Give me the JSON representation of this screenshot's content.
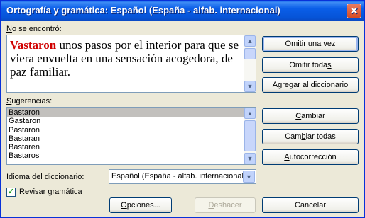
{
  "window": {
    "title": "Ortografía y gramática: Español (España - alfab. internacional)",
    "close_glyph": "✕"
  },
  "not_found": {
    "label_prefix": "",
    "label_u": "N",
    "label_rest": "o se encontró:",
    "error_word": "Vastaron",
    "text_rest": " unos pasos por el interior para que se viera envuelta en una sensación acogedora, de paz familiar."
  },
  "suggestions": {
    "label_u": "S",
    "label_rest": "ugerencias:",
    "items": [
      "Bastaron",
      "Gastaron",
      "Pastaron",
      "Bastaran",
      "Bastaren",
      "Bastaros"
    ]
  },
  "buttons": {
    "ignore_once": {
      "pre": "Omi",
      "u": "t",
      "post": "ir una vez"
    },
    "ignore_all": {
      "pre": "Omitir toda",
      "u": "s",
      "post": ""
    },
    "add_dict": {
      "pre": "A",
      "u": "g",
      "post": "regar al diccionario"
    },
    "change": {
      "pre": "",
      "u": "C",
      "post": "ambiar"
    },
    "change_all": {
      "pre": "Cam",
      "u": "b",
      "post": "iar todas"
    },
    "autocorrect": {
      "pre": "",
      "u": "A",
      "post": "utocorrección"
    },
    "options": {
      "pre": "",
      "u": "O",
      "post": "pciones..."
    },
    "undo": {
      "pre": "",
      "u": "D",
      "post": "eshacer"
    },
    "cancel": {
      "pre": "Cancelar",
      "u": "",
      "post": ""
    }
  },
  "dictionary_language": {
    "label_pre": "Idioma del ",
    "label_u": "d",
    "label_post": "iccionario:",
    "value": "Español (España - alfab. internacional)"
  },
  "check_grammar": {
    "checked": true,
    "label_pre": "",
    "label_u": "R",
    "label_post": "evisar gramática",
    "check_glyph": "✓"
  },
  "icons": {
    "scroll_up": "▲",
    "scroll_down": "▼",
    "dropdown": "▼"
  }
}
